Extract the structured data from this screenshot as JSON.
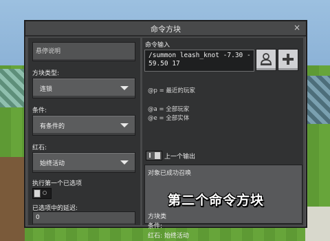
{
  "dialog": {
    "title": "命令方块",
    "close": "×"
  },
  "left_panel": {
    "hover_note": {
      "placeholder": "悬停说明"
    },
    "block_type": {
      "label": "方块类型:",
      "value": "连锁"
    },
    "condition": {
      "label": "条件:",
      "value": "有条件的"
    },
    "redstone": {
      "label": "红石:",
      "value": "始终活动"
    },
    "execute_first": {
      "label": "执行第一个已选项",
      "toggle": "off"
    },
    "delay": {
      "label": "已选项中的延迟:",
      "value": "0"
    }
  },
  "right_panel": {
    "command_input": {
      "label": "命令输入",
      "value": "/summon leash_knot -7.30 -59.50 17"
    },
    "buttons": {
      "paste_icon": "person-paste-icon",
      "add_icon": "plus-icon"
    },
    "help_lines": [
      "@p = 最近的玩家",
      "@a = 全部玩家",
      "@e = 全部实体"
    ],
    "previous_output": {
      "label": "上一个输出",
      "toggle": "on"
    },
    "output_text": "对象已成功召唤",
    "footer": {
      "block_type": "方块类",
      "condition": "条件:",
      "redstone": "红石: 始终活动"
    }
  },
  "overlay_caption": "第二个命令方块",
  "colors": {
    "panel": "#313233",
    "frame": "#48494a",
    "dropdown": "#5b5c5d",
    "button_light": "#d0d1d4"
  }
}
